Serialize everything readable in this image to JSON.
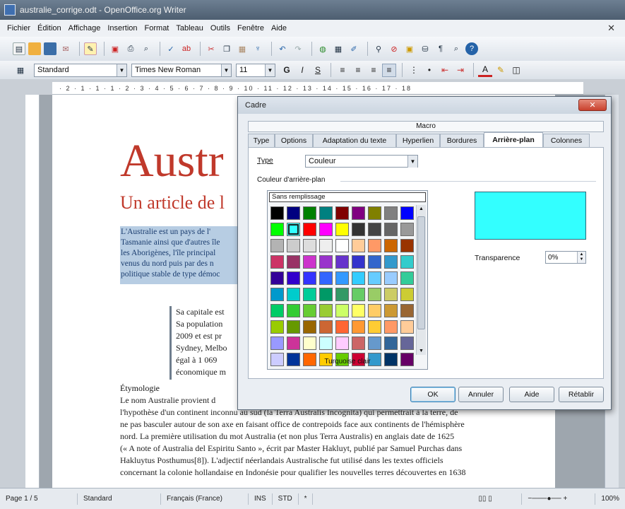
{
  "window": {
    "title": "australie_corrige.odt - OpenOffice.org Writer"
  },
  "menu": [
    "Fichier",
    "Édition",
    "Affichage",
    "Insertion",
    "Format",
    "Tableau",
    "Outils",
    "Fenêtre",
    "Aide"
  ],
  "format_bar": {
    "style": "Standard",
    "font": "Times New Roman",
    "size": "11"
  },
  "ruler": {
    "text": "· 2 · 1 · 1 · 1 · 2 · 3 · 4 · 5 · 6 · 7 · 8 · 9 · 10 · 11 · 12 · 13 · 14 · 15 · 16 · 17 · 18"
  },
  "document": {
    "title": "Austr",
    "subtitle": "Un article de l",
    "para1": [
      "L'Australie est un pays de l'",
      "Tasmanie ainsi que d'autres île",
      "les Aborigènes, l'île principal",
      "venus du nord puis par des n",
      "politique stable de type démoc"
    ],
    "frame_lines": [
      "Sa capitale est",
      "Sa population",
      "2009 et est pr",
      "Sydney, Melbo",
      "égal à 1 069",
      "économique m"
    ],
    "etym_heading": "Étymologie",
    "etym_lines": [
      "Le nom Australie provient d",
      "l'hypothèse d'un continent inconnu au sud (la Terra Australis Incognita) qui permettrait à la terre, de",
      "ne pas basculer autour de son axe en faisant office de contrepoids face aux continents de l'hémisphère",
      "nord. La première utilisation du mot Australia (et non plus Terra Australis) en anglais date de 1625",
      "(« A note of Australia del Espiritu Santo », écrit par Master Hakluyt, publié par Samuel Purchas dans",
      "Hakluytus Posthumus[8]). L'adjectif néerlandais Australische fut utilisé dans les textes officiels",
      "concernant la colonie hollandaise en Indonésie pour qualifier les nouvelles terres découvertes en 1638"
    ]
  },
  "dialog": {
    "title": "Cadre",
    "close": "✕",
    "macro_tab": "Macro",
    "tabs": [
      "Type",
      "Options",
      "Adaptation du texte",
      "Hyperlien",
      "Bordures",
      "Arrière-plan",
      "Colonnes"
    ],
    "active_tab": "Arrière-plan",
    "type_label": "Type",
    "type_value": "Couleur",
    "section_label": "Couleur d'arrière-plan",
    "no_fill": "Sans remplissage",
    "selected_color_name": "Turquoise clair",
    "preview_color": "#33ffff",
    "transparency_label": "Transparence",
    "transparency_value": "0%",
    "buttons": {
      "ok": "OK",
      "cancel": "Annuler",
      "help": "Aide",
      "reset": "Rétablir"
    },
    "palette": [
      "#000000",
      "#000080",
      "#008000",
      "#008080",
      "#800000",
      "#800080",
      "#808000",
      "#808080",
      "#0000ff",
      "#00ff00",
      "#33ffff",
      "#ff0000",
      "#ff00ff",
      "#ffff00",
      "#333333",
      "#444444",
      "#666666",
      "#999999",
      "#b3b3b3",
      "#cccccc",
      "#dddddd",
      "#eeeeee",
      "#ffffff",
      "#ffcc99",
      "#ff9966",
      "#cc6600",
      "#993300",
      "#cc3366",
      "#993366",
      "#cc33cc",
      "#9933cc",
      "#6633cc",
      "#3333cc",
      "#3366cc",
      "#3399cc",
      "#33cccc",
      "#330099",
      "#3300cc",
      "#3333ff",
      "#3366ff",
      "#3399ff",
      "#33ccff",
      "#66ccff",
      "#99ccff",
      "#33cc99",
      "#0099cc",
      "#00cccc",
      "#00cc99",
      "#009966",
      "#339966",
      "#66cc66",
      "#99cc66",
      "#cccc66",
      "#cccc33",
      "#00cc66",
      "#33cc33",
      "#66cc33",
      "#99cc33",
      "#ccff66",
      "#ffff66",
      "#ffcc66",
      "#cc9933",
      "#996633",
      "#99cc00",
      "#669900",
      "#996600",
      "#cc6633",
      "#ff6633",
      "#ff9933",
      "#ffcc33",
      "#ff9966",
      "#ffcc99",
      "#9999ff",
      "#cc3399",
      "#ffffcc",
      "#ccffff",
      "#ffccff",
      "#cc6666",
      "#6699cc",
      "#336699",
      "#666699",
      "#ccccff",
      "#003399",
      "#ff6600",
      "#ffcc00",
      "#66cc00",
      "#cc0033",
      "#3399cc",
      "#003366",
      "#660066"
    ]
  },
  "status": {
    "page": "Page 1 / 5",
    "style": "Standard",
    "language": "Français (France)",
    "ins": "INS",
    "std": "STD",
    "zoom": "100%"
  }
}
